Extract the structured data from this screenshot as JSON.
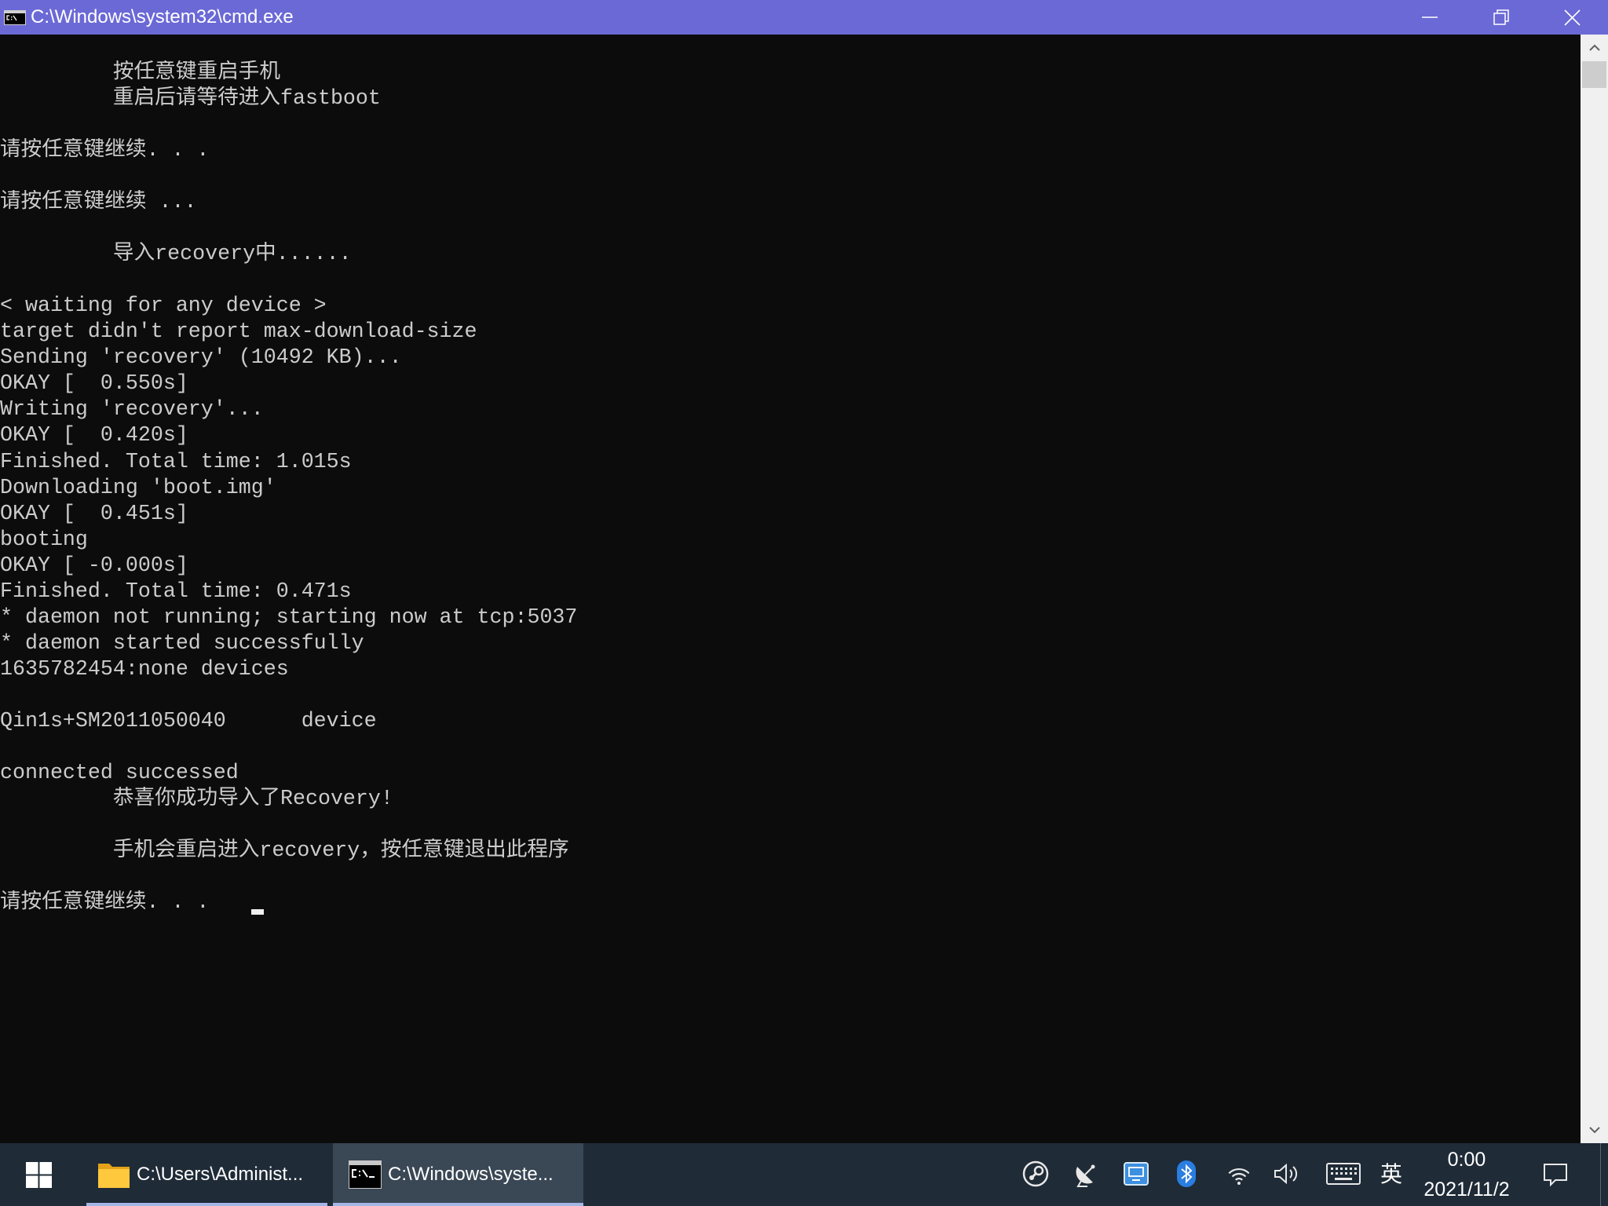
{
  "window": {
    "title": "C:\\Windows\\system32\\cmd.exe",
    "icon": "cmd-icon",
    "controls": {
      "minimize": "minimize-icon",
      "restore": "restore-icon",
      "close": "close-icon"
    },
    "title_bar_color": "#6b69d6"
  },
  "console": {
    "background_color": "#0c0c0c",
    "text_color": "#cccccc",
    "lines": [
      "按任意键重启手机",
      "重启后请等待进入fastboot",
      "请按任意键继续. . .",
      "请按任意键继续 ...",
      "导入recovery中......",
      "< waiting for any device >",
      "target didn't report max-download-size",
      "Sending 'recovery' (10492 KB)...",
      "OKAY [  0.550s]",
      "Writing 'recovery'...",
      "OKAY [  0.420s]",
      "Finished. Total time: 1.015s",
      "Downloading 'boot.img'",
      "OKAY [  0.451s]",
      "booting",
      "OKAY [ -0.000s]",
      "Finished. Total time: 0.471s",
      "* daemon not running; starting now at tcp:5037",
      "* daemon started successfully",
      "1635782454:none devices",
      "Qin1s+SM2011050040      device",
      "connected successed",
      "恭喜你成功导入了Recovery!",
      "手机会重启进入recovery，按任意键退出此程序",
      "请按任意键继续. . ."
    ]
  },
  "scrollbar": {
    "up_icon": "chevron-up-icon",
    "down_icon": "chevron-down-icon",
    "scroll_fraction": 0
  },
  "taskbar": {
    "background_color": "#1f2b37",
    "start_icon": "windows-logo-icon",
    "apps": [
      {
        "label": "C:\\Users\\Administ...",
        "icon": "folder-icon",
        "active": false
      },
      {
        "label": "C:\\Windows\\syste...",
        "icon": "cmd-icon",
        "active": true
      }
    ],
    "tray": {
      "icons": [
        "steam-icon",
        "satellite-dish-icon",
        "app-tray-icon",
        "bluetooth-icon",
        "wifi-icon",
        "volume-icon",
        "touch-keyboard-icon"
      ],
      "input_method": "英",
      "time": "0:00",
      "date": "2021/11/2",
      "notification_icon": "action-center-icon"
    }
  }
}
